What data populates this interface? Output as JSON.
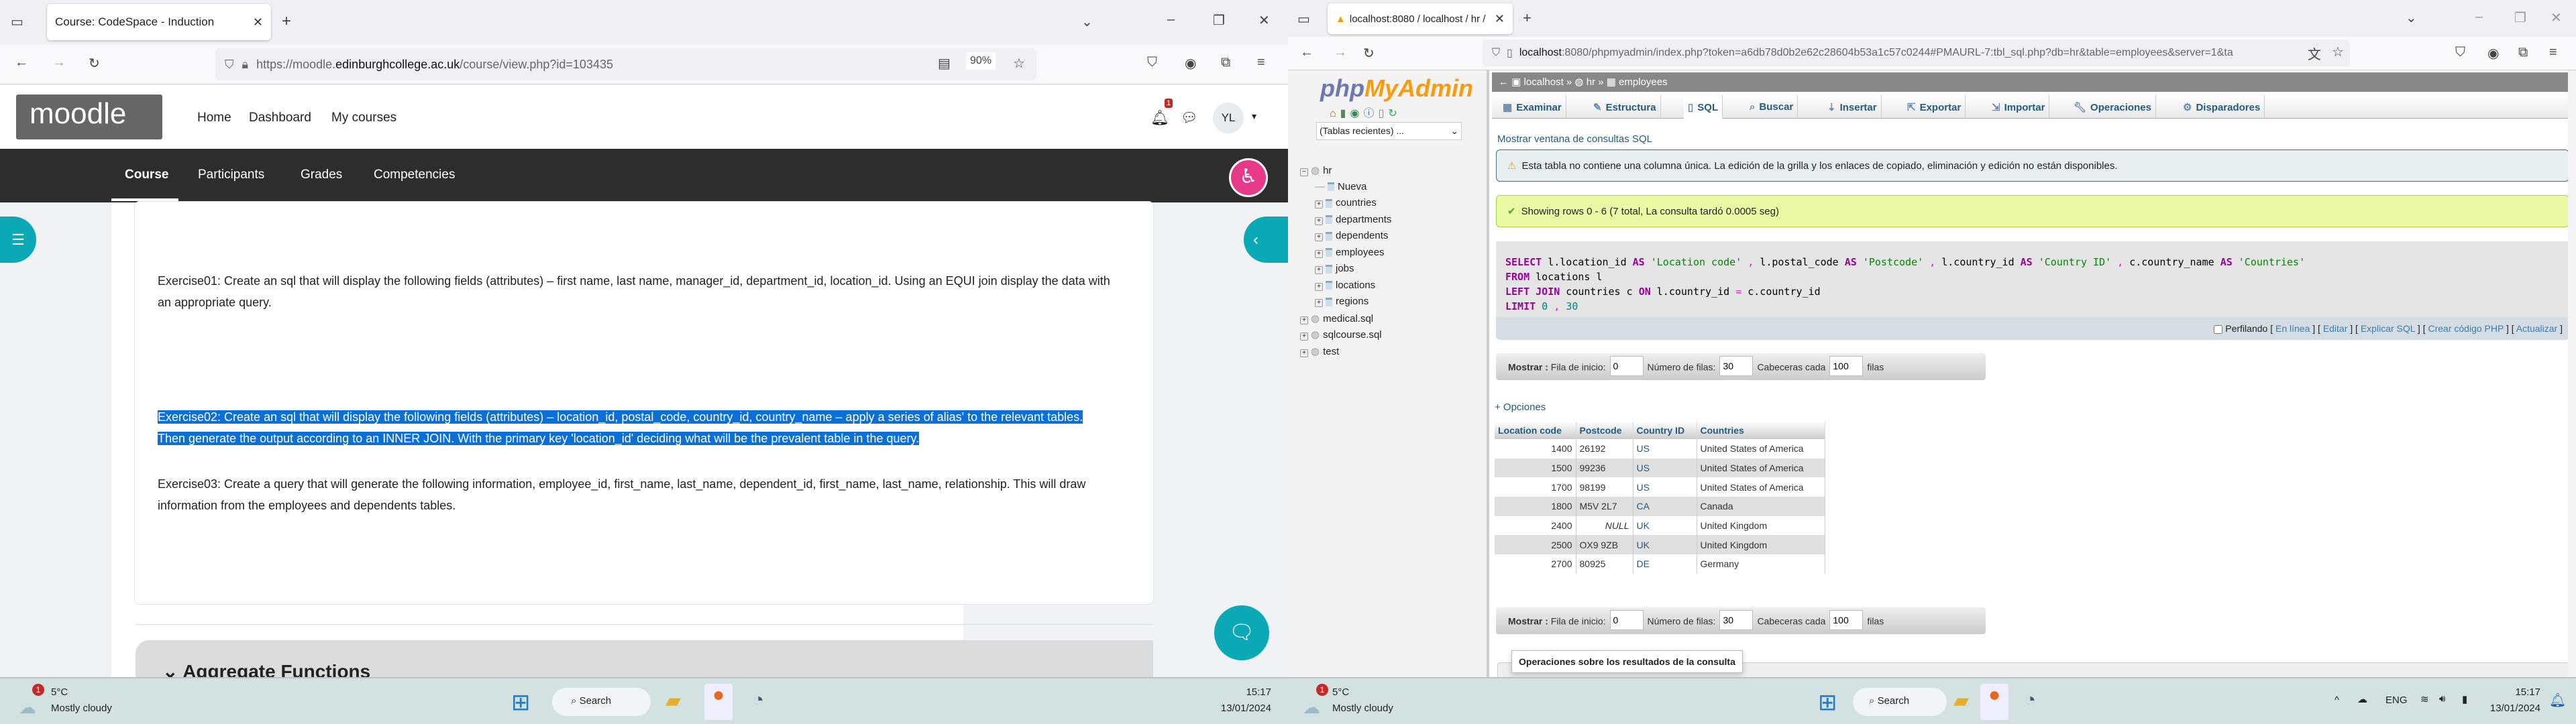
{
  "left": {
    "tab_title": "Course: CodeSpace - Induction",
    "url": {
      "prefix": "https://moodle.",
      "domain": "edinburghcollege.ac.uk",
      "path": "/course/view.php?id=103435"
    },
    "zoom": "90%",
    "logo": "moodle",
    "header_nav": [
      "Home",
      "Dashboard",
      "My courses"
    ],
    "notification_count": "1",
    "avatar": "YL",
    "course_nav": [
      "Course",
      "Participants",
      "Grades",
      "Competencies"
    ],
    "exercises": {
      "ex1": "Exercise01: Create an sql that will display the following fields (attributes) – first name, last name, manager_id, department_id, location_id. Using an EQUI join display the data with an appropriate query.",
      "ex2": "Exercise02: Create an sql that will display the following fields (attributes) – location_id, postal_code, country_id, country_name – apply a series of alias' to the relevant tables. Then generate the output according to an INNER JOIN. With the primary key 'location_id' deciding what will be the prevalent table in the query.",
      "ex3": "Exercise03: Create a query that will generate the following information, employee_id, first_name, last_name, dependent_id, first_name, last_name, relationship. This will draw information from the employees and dependents tables."
    },
    "section_title": "Aggregate Functions",
    "accent": "#0f6cbf",
    "teal": "#0aa9b5",
    "pink": "#e8388a"
  },
  "right": {
    "tab_title": "localhost:8080 / localhost / hr /",
    "url": {
      "host": "localhost",
      "rest": ":8080/phpmyadmin/index.php?token=a6db78d0b2e62c28604b53a1c57c0244#PMAURL-7:tbl_sql.php?db=hr&table=employees&server=1&ta"
    },
    "logo": {
      "php": "php",
      "my": "MyAdmin"
    },
    "recent_tables": "(Tablas recientes) ...",
    "tree": [
      {
        "label": "hr",
        "level": 0,
        "type": "db"
      },
      {
        "label": "Nueva",
        "level": 1,
        "type": "new"
      },
      {
        "label": "countries",
        "level": 1,
        "type": "table"
      },
      {
        "label": "departments",
        "level": 1,
        "type": "table"
      },
      {
        "label": "dependents",
        "level": 1,
        "type": "table"
      },
      {
        "label": "employees",
        "level": 1,
        "type": "table"
      },
      {
        "label": "jobs",
        "level": 1,
        "type": "table"
      },
      {
        "label": "locations",
        "level": 1,
        "type": "table"
      },
      {
        "label": "regions",
        "level": 1,
        "type": "table"
      },
      {
        "label": "medical.sql",
        "level": 0,
        "type": "db"
      },
      {
        "label": "sqlcourse.sql",
        "level": 0,
        "type": "db"
      },
      {
        "label": "test",
        "level": 0,
        "type": "db"
      }
    ],
    "breadcrumb": [
      "localhost",
      "hr",
      "employees"
    ],
    "tabs": [
      "Examinar",
      "Estructura",
      "SQL",
      "Buscar",
      "Insertar",
      "Exportar",
      "Importar",
      "Operaciones",
      "Disparadores"
    ],
    "active_tab": "SQL",
    "show_sql_link": "Mostrar ventana de consultas SQL",
    "warning": "Esta tabla no contiene una columna única. La edición de la grilla y los enlaces de copiado, eliminación y edición no están disponibles.",
    "success": "Showing rows 0 - 6 (7 total, La consulta tardó 0.0005 seg)",
    "sql_lines": [
      [
        {
          "t": "SELECT",
          "c": "kw"
        },
        {
          "t": " l.location_id ",
          "c": "idn"
        },
        {
          "t": "AS",
          "c": "kw"
        },
        {
          "t": " 'Location code'",
          "c": "str"
        },
        {
          "t": " , ",
          "c": "op"
        },
        {
          "t": "l.postal_code ",
          "c": "idn"
        },
        {
          "t": "AS",
          "c": "kw"
        },
        {
          "t": " 'Postcode'",
          "c": "str"
        },
        {
          "t": " , ",
          "c": "op"
        },
        {
          "t": "l.country_id ",
          "c": "idn"
        },
        {
          "t": "AS",
          "c": "kw"
        },
        {
          "t": " 'Country ID'",
          "c": "str"
        },
        {
          "t": " , ",
          "c": "op"
        },
        {
          "t": "c.country_name ",
          "c": "idn"
        },
        {
          "t": "AS",
          "c": "kw"
        },
        {
          "t": " 'Countries'",
          "c": "str"
        }
      ],
      [
        {
          "t": "FROM",
          "c": "kw"
        },
        {
          "t": " locations l",
          "c": "idn"
        }
      ],
      [
        {
          "t": "LEFT JOIN",
          "c": "kw"
        },
        {
          "t": " countries c ",
          "c": "idn"
        },
        {
          "t": "ON",
          "c": "kw"
        },
        {
          "t": " l.country_id ",
          "c": "idn"
        },
        {
          "t": "=",
          "c": "op"
        },
        {
          "t": " c.country_id",
          "c": "idn"
        }
      ],
      [
        {
          "t": "LIMIT",
          "c": "kw"
        },
        {
          "t": " 0",
          "c": "num"
        },
        {
          "t": " , ",
          "c": "op"
        },
        {
          "t": "30",
          "c": "num"
        }
      ]
    ],
    "profiling": {
      "label": "Perfilando",
      "links": [
        "En línea",
        "Editar",
        "Explicar SQL",
        "Crear código PHP",
        "Actualizar"
      ]
    },
    "show_controls": {
      "label": "Mostrar :",
      "start_label": "Fila de inicio:",
      "start": "0",
      "rows_label": "Número de filas:",
      "rows": "30",
      "headers_label": "Cabeceras cada",
      "headers": "100",
      "suffix": "filas"
    },
    "options_link": "+ Opciones",
    "results": {
      "columns": [
        "Location code",
        "Postcode",
        "Country ID",
        "Countries"
      ],
      "rows": [
        [
          "1400",
          "26192",
          "US",
          "United States of America"
        ],
        [
          "1500",
          "99236",
          "US",
          "United States of America"
        ],
        [
          "1700",
          "98199",
          "US",
          "United States of America"
        ],
        [
          "1800",
          "M5V 2L7",
          "CA",
          "Canada"
        ],
        [
          "2400",
          "NULL",
          "UK",
          "United Kingdom"
        ],
        [
          "2500",
          "OX9 9ZB",
          "UK",
          "United Kingdom"
        ],
        [
          "2700",
          "80925",
          "DE",
          "Germany"
        ]
      ]
    },
    "ops_tooltip": "Operaciones sobre los resultados de la consulta"
  },
  "taskbar": {
    "weather_badge": "1",
    "temp": "5°C",
    "condition": "Mostly cloudy",
    "search": "Search",
    "lang": "ENG",
    "time": "15:17",
    "date": "13/01/2024"
  }
}
